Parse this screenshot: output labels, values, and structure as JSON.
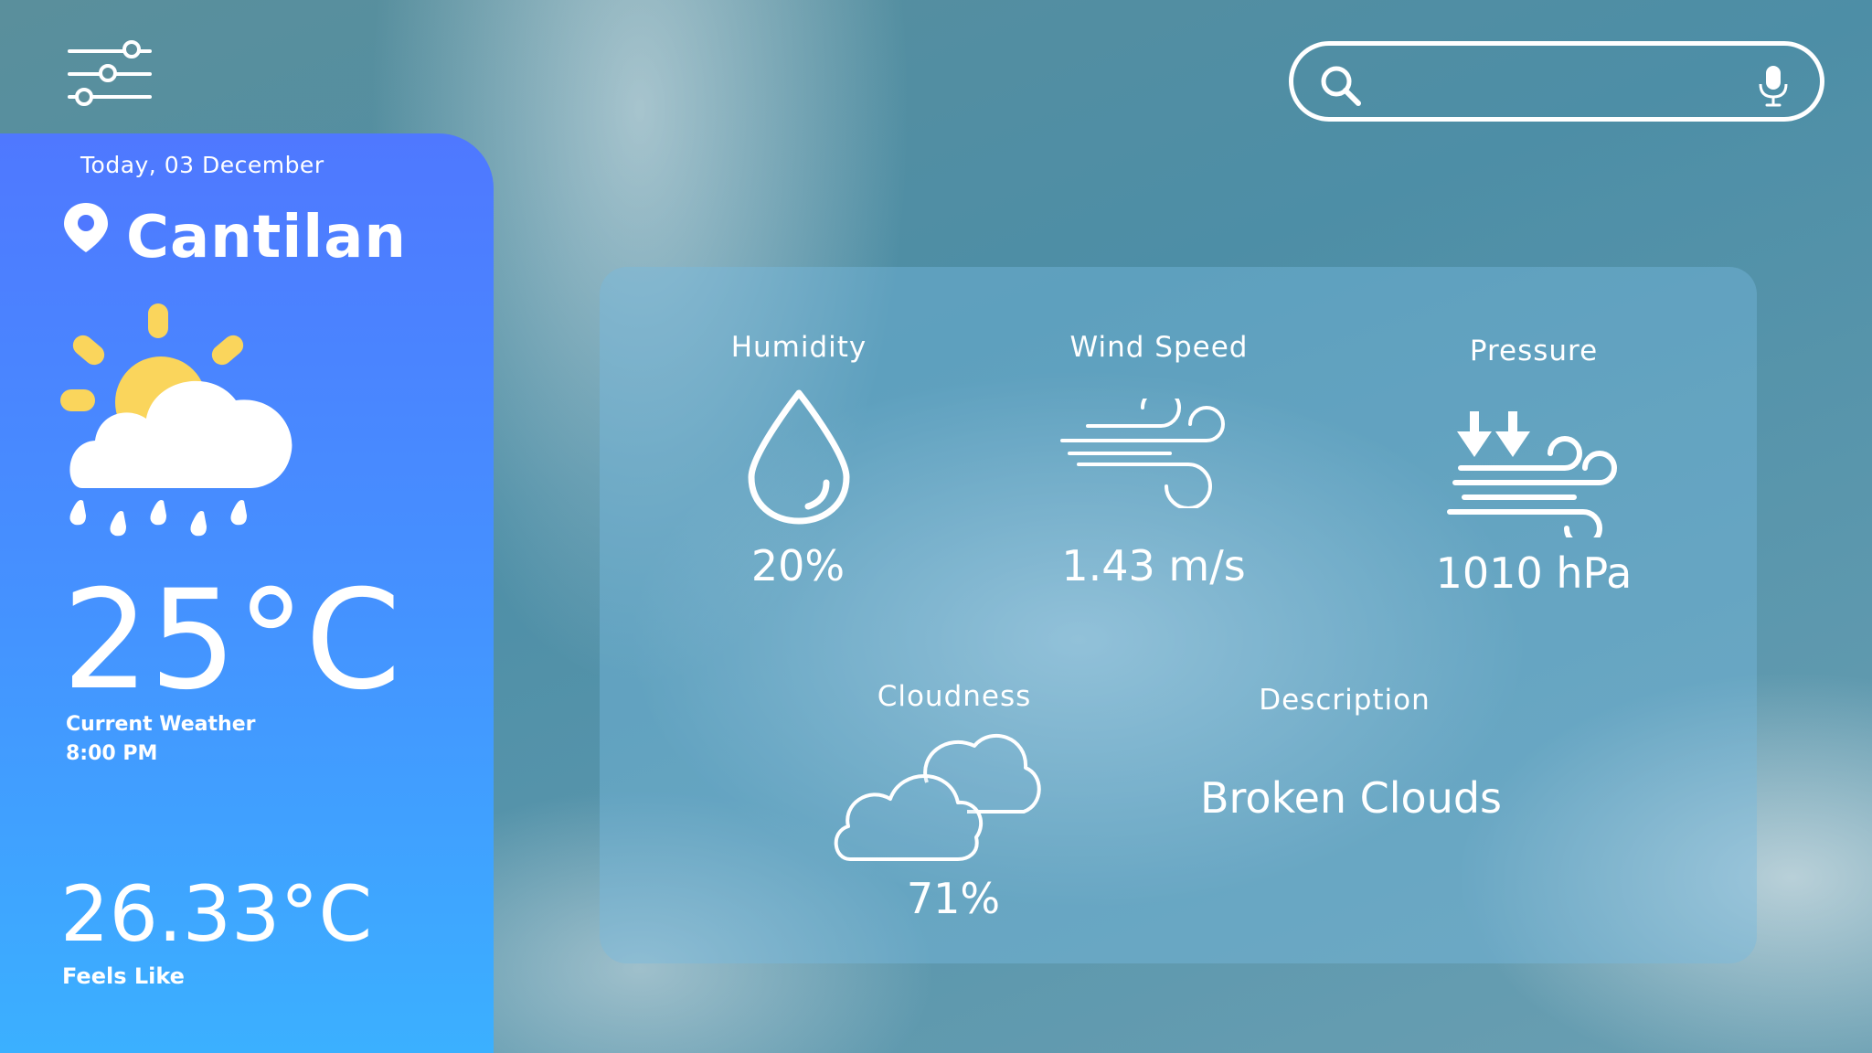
{
  "search": {
    "placeholder": ""
  },
  "current": {
    "date": "Today, 03 December",
    "city": "Cantilan",
    "temperature": "25°C",
    "label": "Current Weather",
    "time": "8:00 PM",
    "feels_like_value": "26.33°C",
    "feels_like_label": "Feels Like"
  },
  "details": {
    "humidity": {
      "label": "Humidity",
      "value": "20%"
    },
    "wind": {
      "label": "Wind Speed",
      "value": "1.43 m/s"
    },
    "pressure": {
      "label": "Pressure",
      "value": "1010 hPa"
    },
    "cloudiness": {
      "label": "Cloudness",
      "value": "71%"
    },
    "description": {
      "label": "Description",
      "value": "Broken Clouds"
    }
  },
  "icons": {
    "filters": "sliders-icon",
    "search": "search-icon",
    "mic": "microphone-icon",
    "location": "location-pin-icon",
    "weather": "sun-cloud-rain-icon",
    "humidity": "water-drop-icon",
    "wind": "wind-icon",
    "pressure": "pressure-icon",
    "clouds": "clouds-icon"
  },
  "colors": {
    "panel_top": "#4f78ff",
    "panel_bottom": "#3bb0ff",
    "sun": "#fad55c",
    "text": "#ffffff"
  }
}
